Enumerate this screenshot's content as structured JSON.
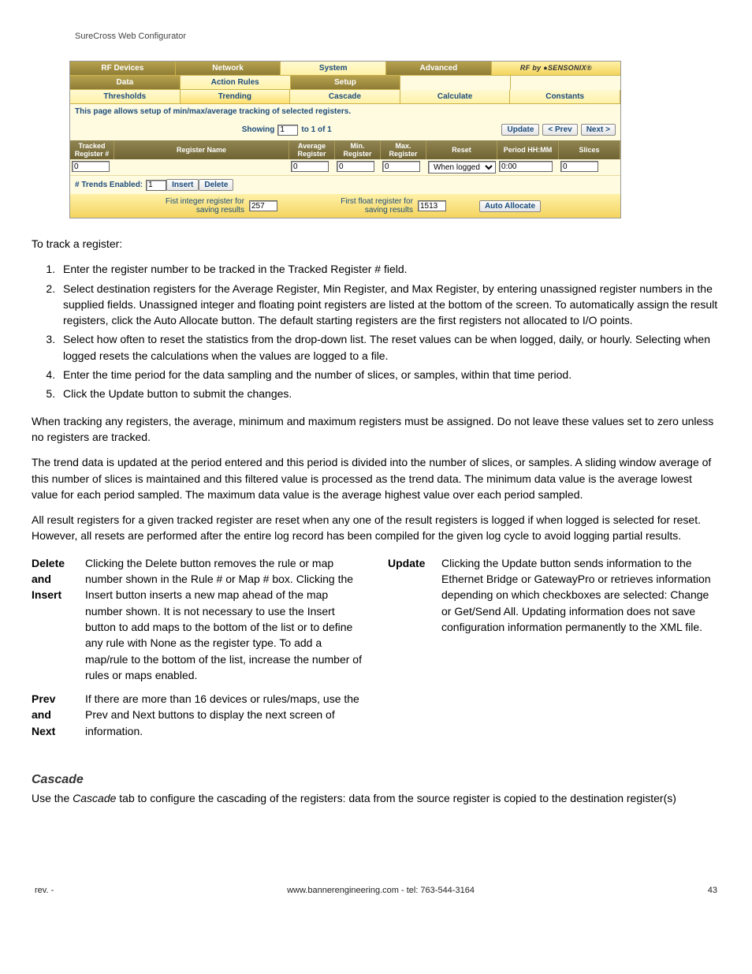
{
  "header": "SureCross Web Configurator",
  "app": {
    "tabs1": [
      "RF Devices",
      "Network",
      "System",
      "Advanced"
    ],
    "brand": "RF by ●SENSONIX®",
    "tabs2": [
      "Data",
      "Action Rules",
      "Setup"
    ],
    "tabs3": [
      "Thresholds",
      "Trending",
      "Cascade",
      "Calculate",
      "Constants"
    ],
    "desc": "This page allows setup of min/max/average tracking of selected registers.",
    "showing_label": "Showing",
    "showing_value": "1",
    "showing_suffix": "to 1 of 1",
    "btn_update": "Update",
    "btn_prev": "< Prev",
    "btn_next": "Next >",
    "cols": {
      "tracked": "Tracked Register #",
      "name": "Register Name",
      "avg": "Average Register",
      "min": "Min. Register",
      "max": "Max. Register",
      "reset": "Reset",
      "period": "Period HH:MM",
      "slices": "Slices"
    },
    "row": {
      "tracked": "0",
      "name": "",
      "avg": "0",
      "min": "0",
      "max": "0",
      "reset": "When logged",
      "period": "0:00",
      "slices": "0"
    },
    "trends_label": "# Trends Enabled:",
    "trends_value": "1",
    "btn_insert": "Insert",
    "btn_delete": "Delete",
    "int_label": "Fist integer register for saving results",
    "int_value": "257",
    "float_label": "First float register for saving results",
    "float_value": "1513",
    "btn_auto": "Auto Allocate"
  },
  "doc": {
    "intro": "To track a register:",
    "steps": [
      "Enter the register number to be tracked in the Tracked Register # field.",
      "Select destination registers for the Average Register, Min Register, and Max Register, by entering unassigned register numbers in the supplied fields. Unassigned integer and floating point registers are listed at the bottom of the screen. To automatically assign the result registers, click the Auto Allocate button. The default starting registers are the first registers not allocated to I/O points.",
      "Select how often to reset the statistics from the drop-down list. The reset values can be when logged, daily, or hourly. Selecting when logged resets the calculations when the values are logged to a file.",
      "Enter the time period for the data sampling and the number of slices, or samples, within that time period.",
      "Click the Update button to submit the changes."
    ],
    "p1": "When tracking any registers, the average, minimum and maximum registers must be assigned. Do not leave these values set to zero unless no registers are tracked.",
    "p2": "The trend data is updated at the period entered and this period is divided into the number of slices, or samples. A sliding window average of this number of slices is maintained and this filtered value is processed as the trend data. The minimum data value is the average lowest value for each period sampled. The maximum data value is the average highest value over each period sampled.",
    "p3": "All result registers for a given tracked register are reset when any one of the result registers is logged if when logged is selected for reset. However, all resets are performed after the entire log record has been compiled for the given log cycle to avoid logging partial results.",
    "defs": {
      "delins_term": "Delete and Insert",
      "delins_def": "Clicking the Delete button removes the rule or map number shown in the Rule # or Map # box. Clicking the Insert button inserts a new map ahead of the map number shown. It is not necessary to use the Insert button to add maps to the bottom of the list or to define any rule with None as the register type. To add a map/rule to the bottom of the list, increase the number of rules or maps enabled.",
      "prevnext_term": "Prev and Next",
      "prevnext_def": "If there are more than 16 devices or rules/maps, use the Prev and Next buttons to display the next screen of information.",
      "update_term": "Update",
      "update_def": "Clicking the Update button sends information to the Ethernet Bridge or GatewayPro or retrieves information depending on which checkboxes are selected: Change or Get/Send All. Updating information does not save configuration information permanently to the XML file."
    },
    "cascade_h": "Cascade",
    "cascade_p_a": "Use the ",
    "cascade_p_i": "Cascade",
    "cascade_p_b": " tab to configure the cascading of the registers: data from the source register is copied to the destination register(s)"
  },
  "footer": {
    "rev": "rev. -",
    "site": "www.bannerengineering.com - tel: 763-544-3164",
    "page": "43"
  }
}
